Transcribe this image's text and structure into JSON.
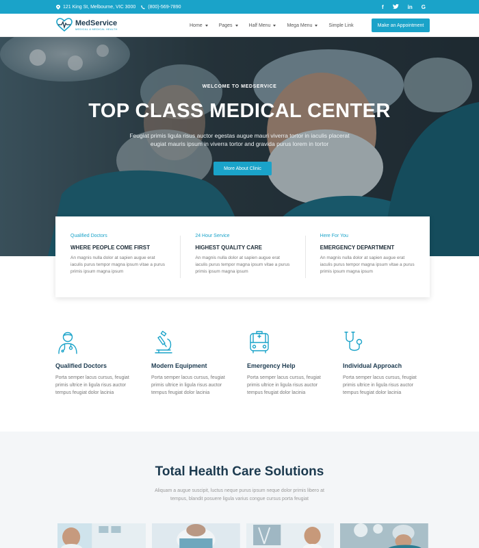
{
  "topbar": {
    "address": "121 King St, Melbourne, VIC 3000",
    "phone": "(800)-569-7890",
    "social": [
      "f",
      "t",
      "in",
      "G"
    ]
  },
  "header": {
    "logo_name": "MedService",
    "logo_tagline": "MEDICAL & MEDICAL HEALTH",
    "nav": [
      {
        "label": "Home",
        "dropdown": true
      },
      {
        "label": "Pages",
        "dropdown": true
      },
      {
        "label": "Half Menu",
        "dropdown": true
      },
      {
        "label": "Mega Menu",
        "dropdown": true
      },
      {
        "label": "Simple Link",
        "dropdown": false
      }
    ],
    "cta_label": "Make an Appointment"
  },
  "hero": {
    "kicker": "WELCOME TO MEDSERVICE",
    "title": "TOP CLASS MEDICAL CENTER",
    "description": "Feugiat primis ligula risus auctor egestas augue mauri viverra tortor in iaculis placerat eugiat mauris ipsum in viverra tortor and gravida purus lorem in tortor",
    "button_label": "More About Clinic"
  },
  "info_cards": [
    {
      "kicker": "Qualified Doctors",
      "title": "WHERE PEOPLE COME FIRST",
      "text": "An magnis nulla dolor at sapien augue erat iaculis purus tempor magna ipsum vitae a purus primis ipsum magna ipsum"
    },
    {
      "kicker": "24 Hour Service",
      "title": "HIGHEST QUALITY CARE",
      "text": "An magnis nulla dolor at sapien augue erat iaculis purus tempor magna ipsum vitae a purus primis ipsum magna ipsum"
    },
    {
      "kicker": "Here For You",
      "title": "EMERGENCY DEPARTMENT",
      "text": "An magnis nulla dolor at sapien augue erat iaculis purus tempor magna ipsum vitae a purus primis ipsum magna ipsum"
    }
  ],
  "features": [
    {
      "icon": "doctor-icon",
      "title": "Qualified Doctors",
      "text": "Porta semper lacus cursus, feugiat primis ultrice in ligula risus auctor tempus feugiat dolor lacinia"
    },
    {
      "icon": "microscope-icon",
      "title": "Modern Equipment",
      "text": "Porta semper lacus cursus, feugiat primis ultrice in ligula risus auctor tempus feugiat dolor lacinia"
    },
    {
      "icon": "ambulance-icon",
      "title": "Emergency Help",
      "text": "Porta semper lacus cursus, feugiat primis ultrice in ligula risus auctor tempus feugiat dolor lacinia"
    },
    {
      "icon": "stethoscope-icon",
      "title": "Individual Approach",
      "text": "Porta semper lacus cursus, feugiat primis ultrice in ligula risus auctor tempus feugiat dolor lacinia"
    }
  ],
  "solutions": {
    "title": "Total Health Care Solutions",
    "description": "Aliquam a augue suscipit, luctus neque purus ipsum neque dolor primis libero at tempus, blandit posuere ligula varius congue cursus porta feugiat"
  },
  "colors": {
    "accent": "#1aa3c9",
    "heading": "#1c3a4f"
  }
}
